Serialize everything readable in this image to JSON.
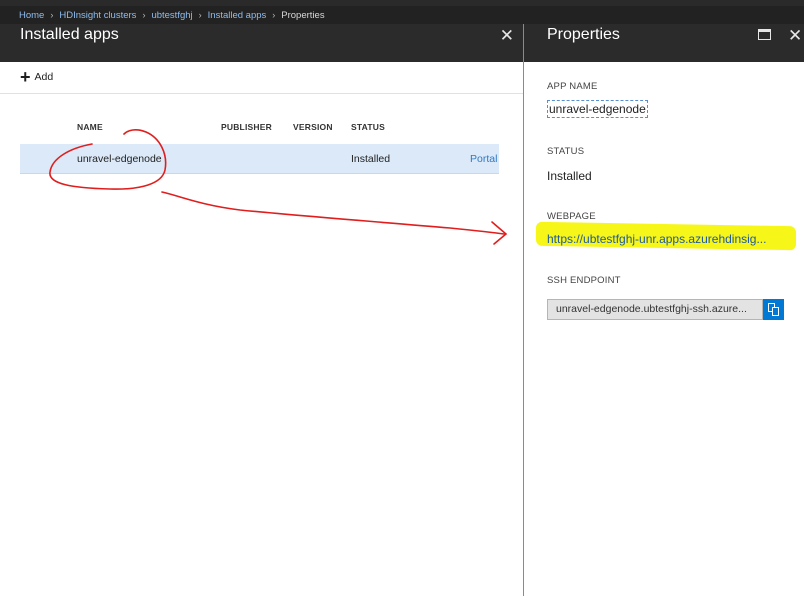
{
  "breadcrumb": {
    "items": [
      "Home",
      "HDInsight clusters",
      "ubtestfghj",
      "Installed apps"
    ],
    "current": "Properties",
    "separator": "›"
  },
  "left_blade": {
    "title": "Installed apps",
    "close_glyph": "✕",
    "toolbar": {
      "add_label": "Add",
      "add_icon": "plus-icon"
    },
    "table": {
      "columns": [
        "NAME",
        "PUBLISHER",
        "VERSION",
        "STATUS"
      ],
      "rows": [
        {
          "name": "unravel-edgenode",
          "publisher": "",
          "version": "",
          "status": "Installed",
          "action": "Portal"
        }
      ]
    }
  },
  "right_blade": {
    "title": "Properties",
    "close_glyph": "✕",
    "app_name_label": "APP NAME",
    "app_name": "unravel-edgenode",
    "status_label": "STATUS",
    "status": "Installed",
    "webpage_label": "WEBPAGE",
    "webpage": "https://ubtestfghj-unr.apps.azurehdinsig...",
    "ssh_label": "SSH ENDPOINT",
    "ssh_endpoint": "unravel-edgenode.ubtestfghj-ssh.azure...",
    "copy_icon": "copy-icon"
  },
  "colors": {
    "header_bg": "#2b2b2b",
    "row_selected": "#dbe9f8",
    "link": "#2d7ac7",
    "accent": "#0078d4",
    "highlight": "#f5f500",
    "annotation": "#e01e1e"
  }
}
